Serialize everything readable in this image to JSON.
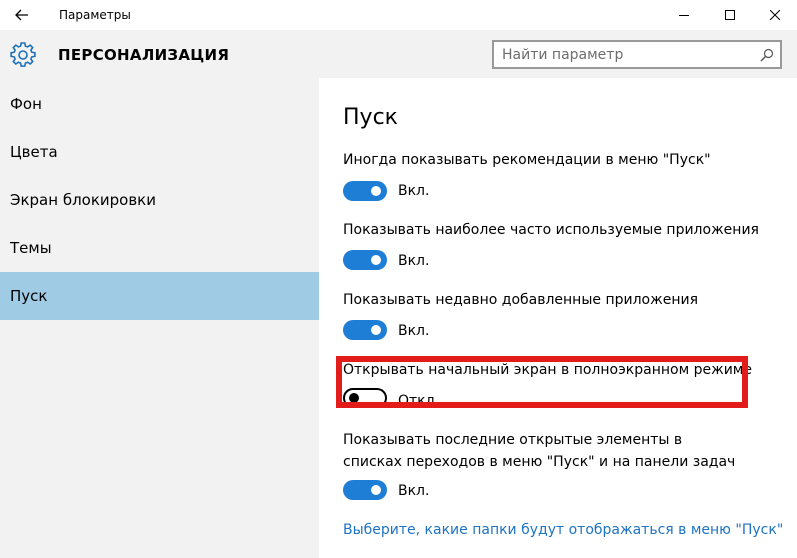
{
  "window": {
    "title": "Параметры"
  },
  "icons": {
    "back": "back-arrow-icon",
    "minimize": "minimize-icon",
    "maximize": "maximize-icon",
    "close": "close-icon",
    "gear": "gear-icon",
    "search": "search-icon"
  },
  "header": {
    "title": "ПЕРСОНАЛИЗАЦИЯ"
  },
  "search": {
    "placeholder": "Найти параметр",
    "value": ""
  },
  "sidebar": {
    "items": [
      {
        "label": "Фон",
        "selected": false
      },
      {
        "label": "Цвета",
        "selected": false
      },
      {
        "label": "Экран блокировки",
        "selected": false
      },
      {
        "label": "Темы",
        "selected": false
      },
      {
        "label": "Пуск",
        "selected": true
      }
    ]
  },
  "main": {
    "heading": "Пуск",
    "settings": [
      {
        "label": "Иногда показывать рекомендации в меню \"Пуск\"",
        "state": "Вкл.",
        "on": true
      },
      {
        "label": "Показывать наиболее часто используемые приложения",
        "state": "Вкл.",
        "on": true
      },
      {
        "label": "Показывать недавно добавленные приложения",
        "state": "Вкл.",
        "on": true
      },
      {
        "label": "Открывать начальный экран в полноэкранном режиме",
        "state": "Откл.",
        "on": false
      },
      {
        "label": "Показывать последние открытые элементы в списках переходов в меню \"Пуск\" и на панели задач",
        "state": "Вкл.",
        "on": true
      }
    ],
    "link": "Выберите, какие папки будут отображаться в меню \"Пуск\""
  },
  "colors": {
    "accent": "#1e7dd4",
    "link": "#1e73c4",
    "sidebar_bg": "#f2f2f2",
    "selected_bg": "#9fcbe5",
    "highlight": "#e21b1b"
  }
}
